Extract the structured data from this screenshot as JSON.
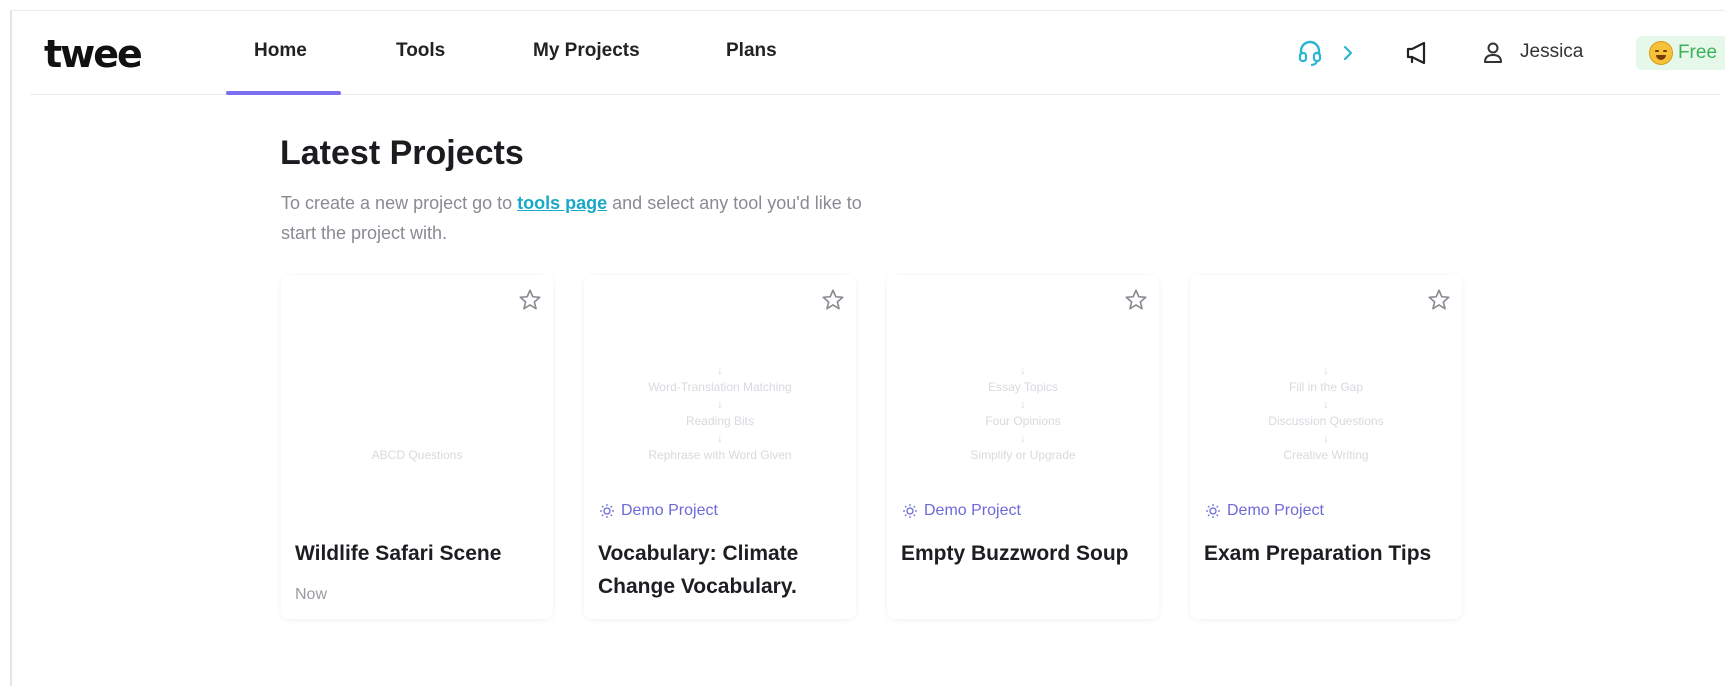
{
  "app": {
    "logo": "twee"
  },
  "nav": {
    "items": [
      {
        "label": "Home",
        "active": true
      },
      {
        "label": "Tools"
      },
      {
        "label": "My Projects"
      },
      {
        "label": "Plans"
      }
    ],
    "accent": "#7b6ef0"
  },
  "header": {
    "support_icon": "headset-icon",
    "support_chevron": "chevron-right-icon",
    "announcements_icon": "megaphone-icon",
    "user_icon": "user-icon",
    "user_name": "Jessica",
    "plan_label": "Free",
    "plan_color": "#3bb25a"
  },
  "main": {
    "heading": "Latest Projects",
    "subtitle_before": "To create a new project go to ",
    "subtitle_link": "tools page",
    "subtitle_after": " and select any tool you'd like to start the project with.",
    "link_color": "#19a9c8"
  },
  "projects": [
    {
      "title": "Wildlife Safari Scene",
      "date": "Now",
      "demo": false,
      "steps": [
        "ABCD Questions"
      ]
    },
    {
      "title": "Vocabulary: Climate Change Vocabulary.",
      "badge": "Demo Project",
      "demo": true,
      "steps": [
        "Word-Translation Matching",
        "Reading Bits",
        "Rephrase with Word Given"
      ]
    },
    {
      "title": "Empty Buzzword Soup",
      "badge": "Demo Project",
      "demo": true,
      "steps": [
        "Essay Topics",
        "Four Opinions",
        "Simplify or Upgrade"
      ]
    },
    {
      "title": "Exam Preparation Tips",
      "badge": "Demo Project",
      "demo": true,
      "steps": [
        "Fill in the Gap",
        "Discussion Questions",
        "Creative Writing"
      ]
    }
  ]
}
